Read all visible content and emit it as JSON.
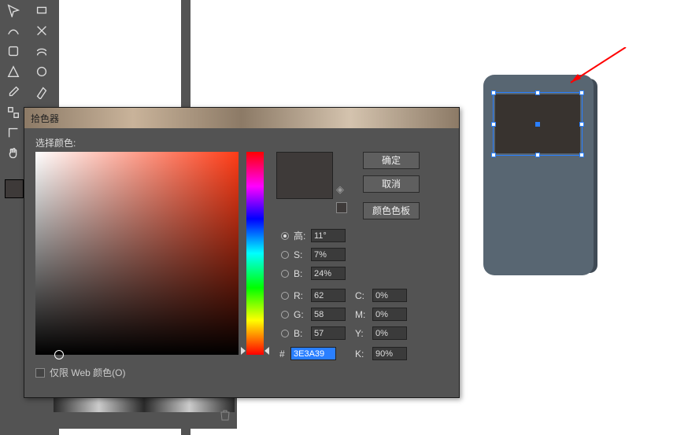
{
  "dialog": {
    "title": "拾色器",
    "prompt": "选择颜色:",
    "ok": "确定",
    "cancel": "取消",
    "swatches": "颜色色板",
    "webonly": "仅限 Web 颜色(O)",
    "labels": {
      "h": "高:",
      "s": "S:",
      "b": "B:",
      "r": "R:",
      "g": "G:",
      "bb": "B:",
      "hex": "#",
      "c": "C:",
      "m": "M:",
      "y": "Y:",
      "k": "K:"
    },
    "values": {
      "h": "11°",
      "s": "7%",
      "b": "24%",
      "r": "62",
      "g": "58",
      "bb": "57",
      "hex": "3E3A39",
      "c": "0%",
      "m": "0%",
      "y": "0%",
      "k": "90%"
    }
  }
}
